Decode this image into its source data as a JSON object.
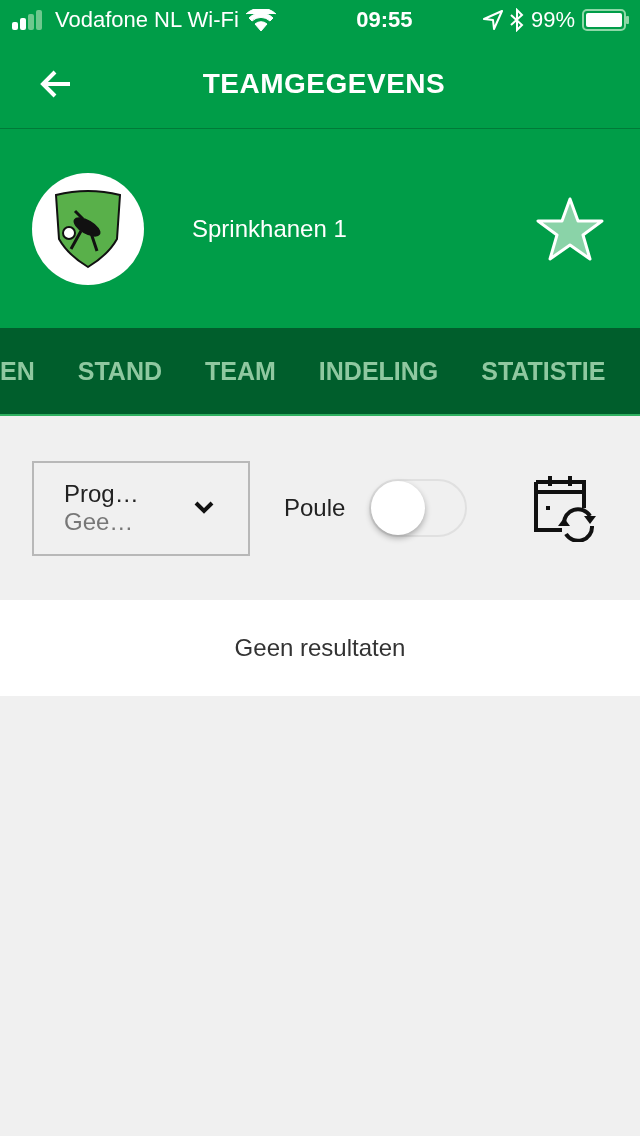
{
  "status_bar": {
    "carrier": "Vodafone NL Wi-Fi",
    "time": "09:55",
    "battery": "99%"
  },
  "nav": {
    "title": "TEAMGEGEVENS"
  },
  "team": {
    "name": "Sprinkhanen 1",
    "favorite": true
  },
  "tabs": [
    {
      "label": "EN"
    },
    {
      "label": "STAND"
    },
    {
      "label": "TEAM"
    },
    {
      "label": "INDELING"
    },
    {
      "label": "STATISTIE"
    }
  ],
  "filter": {
    "dropdown": {
      "label": "Prog…",
      "value": "Gee…"
    },
    "toggle": {
      "label": "Poule",
      "on": false
    }
  },
  "results": {
    "message": "Geen resultaten"
  }
}
